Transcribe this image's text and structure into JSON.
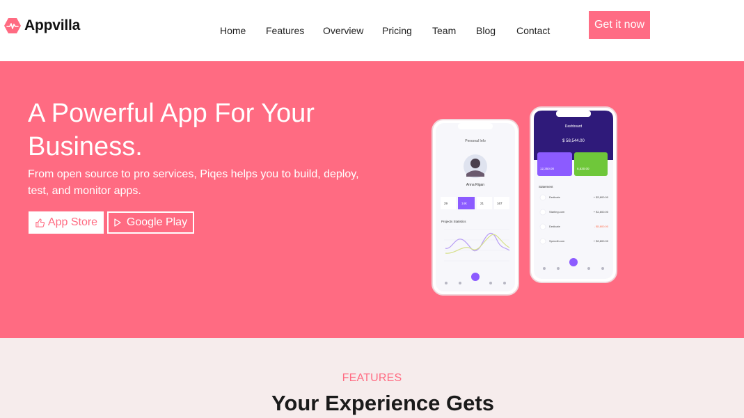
{
  "brand": {
    "name": "Appvilla",
    "accent": "#ff6b82"
  },
  "nav": {
    "items": [
      {
        "label": "Home"
      },
      {
        "label": "Features"
      },
      {
        "label": "Overview"
      },
      {
        "label": "Pricing"
      },
      {
        "label": "Team"
      },
      {
        "label": "Blog"
      },
      {
        "label": "Contact"
      }
    ],
    "cta_label": "Get it now"
  },
  "hero": {
    "title": "A Powerful App For Your Business.",
    "subtitle": "From open source to pro services, Piqes helps you to build, deploy, test, and monitor apps.",
    "app_store_label": "App Store",
    "google_play_label": "Google Play",
    "phone_left": {
      "title": "Personal Info",
      "name": "Anna Rigan",
      "stats": [
        "29",
        "14K",
        "21",
        "167"
      ],
      "section": "Projects Statistics"
    },
    "phone_right": {
      "title": "Dashboard",
      "balance": "$ 58,544.00",
      "card1_amount": "12,350.00",
      "card2_amount": "6,530.00",
      "section": "Statement",
      "rows": [
        {
          "name": "Dedicate",
          "amount": "+ $3,800.00"
        },
        {
          "name": "Starling.com",
          "amount": "+ $1,600.00"
        },
        {
          "name": "Dedicate",
          "amount": "- $5,800.00"
        },
        {
          "name": "Spendit.com",
          "amount": "+ $3,800.00"
        }
      ]
    }
  },
  "features": {
    "label": "FEATURES",
    "title": "Your Experience Gets"
  }
}
